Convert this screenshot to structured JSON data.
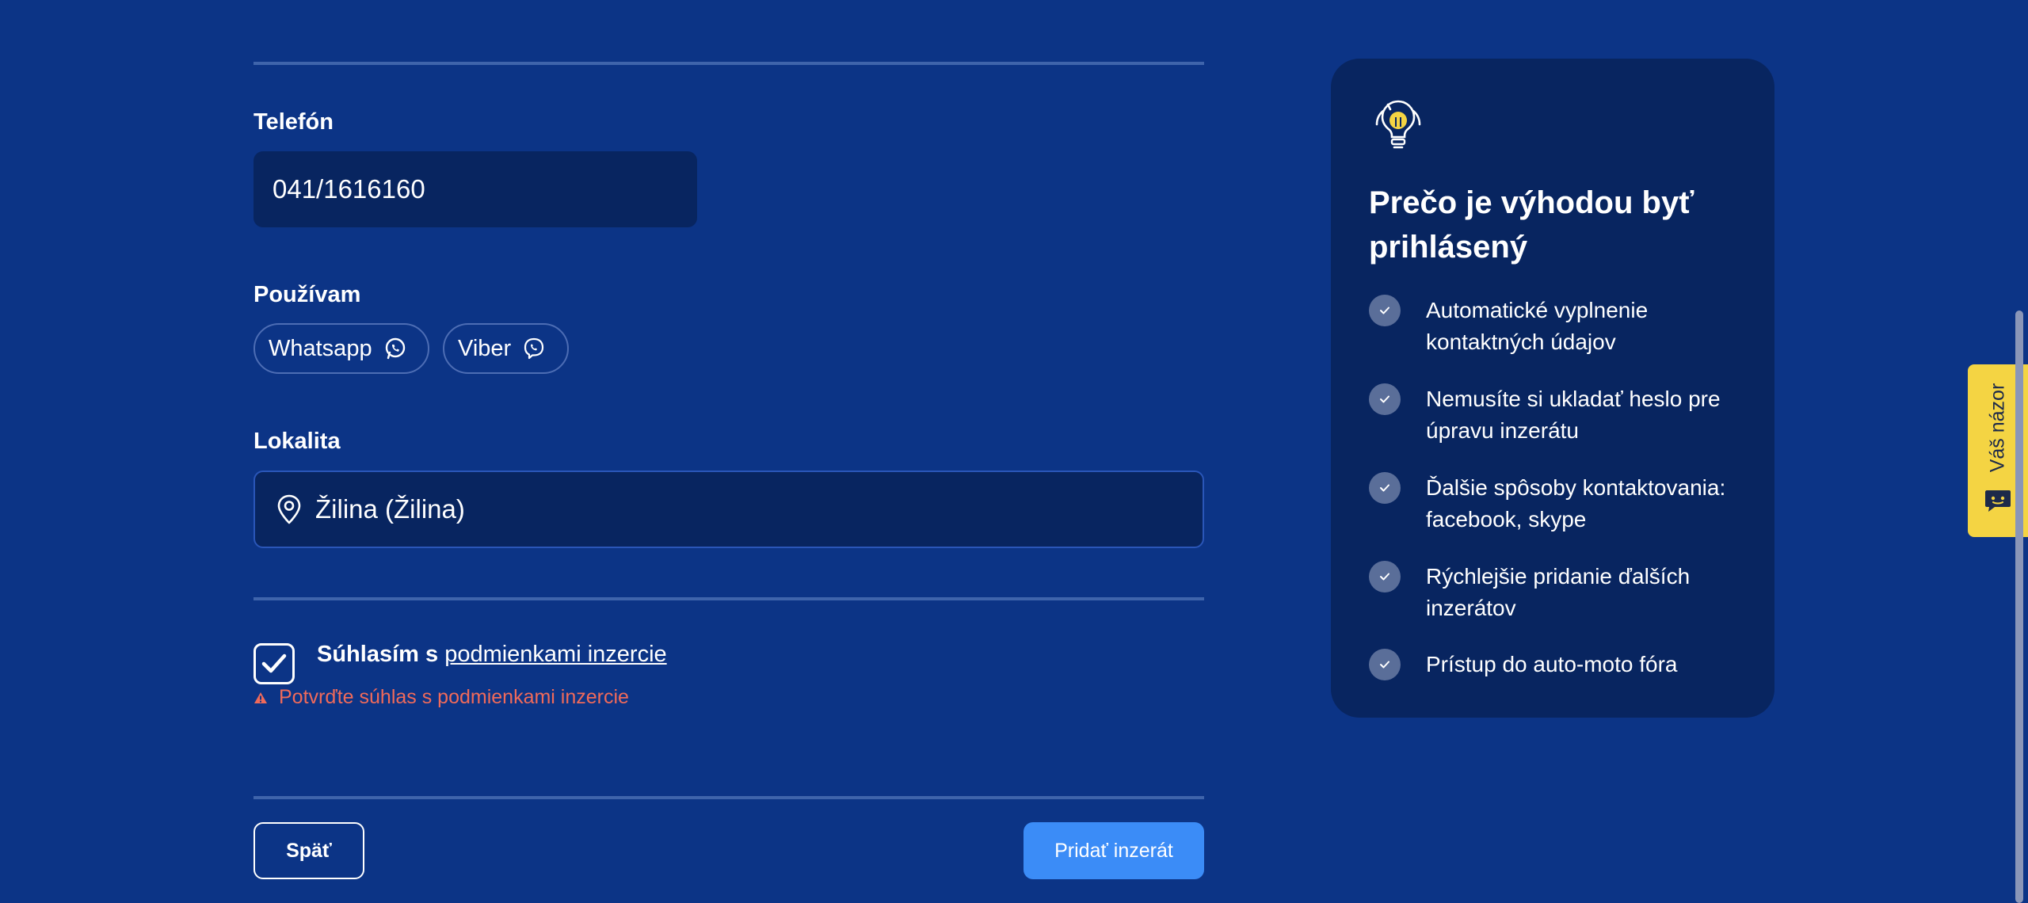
{
  "form": {
    "phone": {
      "label": "Telefón",
      "value": "041/1616160"
    },
    "messengers": {
      "label": "Používam",
      "options": [
        {
          "label": "Whatsapp",
          "icon": "whatsapp-icon"
        },
        {
          "label": "Viber",
          "icon": "viber-icon"
        }
      ]
    },
    "location": {
      "label": "Lokalita",
      "value": "Žilina (Žilina)",
      "icon": "location-pin-icon"
    },
    "consent": {
      "checked": true,
      "prefix": "Súhlasím s",
      "link": "podmienkami inzercie",
      "error": "Potvrďte súhlas s podmienkami inzercie"
    },
    "actions": {
      "back": "Späť",
      "submit": "Pridať inzerát"
    }
  },
  "sidebar": {
    "icon": "lightbulb-icon",
    "title": "Prečo je výhodou byť prihlásený",
    "benefits": [
      "Automatické vyplnenie kontaktných údajov",
      "Nemusíte si ukladať heslo pre úpravu inzerátu",
      "Ďalšie spôsoby kontaktovania: facebook, skype",
      "Rýchlejšie pridanie ďalších inzerátov",
      "Prístup do auto-moto fóra"
    ]
  },
  "feedback": {
    "label": "Váš názor",
    "icon": "chat-bot-icon"
  },
  "colors": {
    "background": "#0c3486",
    "panel": "#082560",
    "accent_button": "#3b8cf7",
    "error": "#f06a5a",
    "feedback_tab": "#f4d443"
  }
}
